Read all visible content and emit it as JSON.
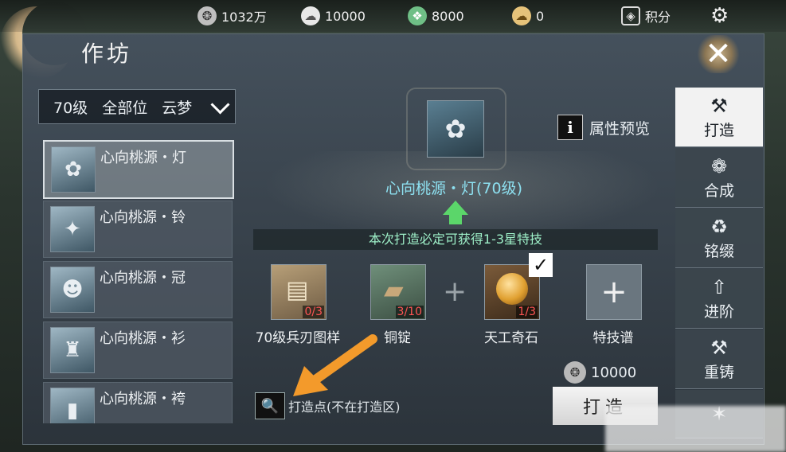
{
  "topbar": {
    "currencies": [
      {
        "icon": "copper-coin-icon",
        "glyph": "❂",
        "value": "1032万",
        "color": "#d8d8d8"
      },
      {
        "icon": "silver-ingot-icon",
        "glyph": "☁",
        "value": "10000",
        "color": "#e8e8e8"
      },
      {
        "icon": "jade-icon",
        "glyph": "❖",
        "value": "8000",
        "color": "#8fd6a0"
      },
      {
        "icon": "gold-ingot-icon",
        "glyph": "☁",
        "value": "0",
        "color": "#e6c37a"
      }
    ],
    "points_label": "积分",
    "points_icon": "shield-icon"
  },
  "window": {
    "title": "作坊"
  },
  "filter": {
    "level": "70级",
    "slot": "全部位",
    "school": "云梦"
  },
  "items": [
    {
      "name": "心向桃源・灯",
      "icon": "lantern-icon",
      "glyph": "✿",
      "selected": true
    },
    {
      "name": "心向桃源・铃",
      "icon": "bell-icon",
      "glyph": "✦",
      "selected": false
    },
    {
      "name": "心向桃源・冠",
      "icon": "crown-portrait-icon",
      "glyph": "☻",
      "selected": false
    },
    {
      "name": "心向桃源・衫",
      "icon": "robe-icon",
      "glyph": "♜",
      "selected": false
    },
    {
      "name": "心向桃源・袴",
      "icon": "trousers-icon",
      "glyph": "▮",
      "selected": false
    }
  ],
  "target": {
    "name": "心向桃源・灯(70级)",
    "banner": "本次打造必定可获得1-3星特技",
    "attr_label": "属性预览",
    "attr_icon_text": "i"
  },
  "materials": [
    {
      "label": "70级兵刃图样",
      "count": "0/3",
      "icon": "blueprint-book-icon",
      "glyph": "📜"
    },
    {
      "label": "铜锭",
      "count": "3/10",
      "icon": "copper-ingot-icon",
      "glyph": "▰"
    },
    {
      "label": "天工奇石",
      "count": "1/3",
      "icon": "magic-stone-icon",
      "glyph": "●"
    },
    {
      "label": "特技谱",
      "count": "",
      "icon": "add-slot-icon",
      "glyph": "+"
    }
  ],
  "cost": {
    "value": "10000",
    "icon": "copper-coin-icon"
  },
  "forge_button": "打造",
  "forge_point": "打造点(不在打造区)",
  "tabs": [
    {
      "label": "打造",
      "icon": "anvil-icon",
      "glyph": "⚒",
      "active": true
    },
    {
      "label": "合成",
      "icon": "synthesis-icon",
      "glyph": "❁",
      "active": false
    },
    {
      "label": "铭缀",
      "icon": "recycle-icon",
      "glyph": "♻",
      "active": false
    },
    {
      "label": "进阶",
      "icon": "upgrade-icon",
      "glyph": "⇧",
      "active": false
    },
    {
      "label": "重铸",
      "icon": "hammer-icon",
      "glyph": "🔨",
      "active": false
    },
    {
      "label": "",
      "icon": "fire-icon",
      "glyph": "✶",
      "active": false
    }
  ],
  "colors": {
    "accent_text": "#8de0f0",
    "banner_text": "#9ef0c8",
    "count_red": "#ff5555",
    "arrow_orange": "#f39a2b"
  }
}
